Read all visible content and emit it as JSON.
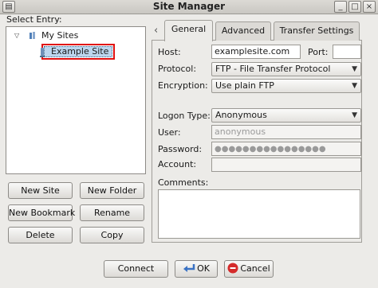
{
  "window": {
    "title": "Site Manager",
    "controls": {
      "minimize": "_",
      "maximize": "□",
      "close": "×"
    }
  },
  "tree": {
    "select_entry_label": "Select Entry:",
    "root_label": "My Sites",
    "selected_label": "Example Site",
    "expander": "▽"
  },
  "left_buttons": {
    "new_site": "New Site",
    "new_folder": "New Folder",
    "new_bookmark": "New Bookmark",
    "rename": "Rename",
    "delete": "Delete",
    "copy": "Copy"
  },
  "tabs": {
    "scroll_left": "‹",
    "items": [
      "General",
      "Advanced",
      "Transfer Settings"
    ],
    "active": "General"
  },
  "general": {
    "host_label": "Host:",
    "host_value": "examplesite.com",
    "port_label": "Port:",
    "port_value": "",
    "protocol_label": "Protocol:",
    "protocol_value": "FTP - File Transfer Protocol",
    "encryption_label": "Encryption:",
    "encryption_value": "Use plain FTP",
    "logon_type_label": "Logon Type:",
    "logon_type_value": "Anonymous",
    "user_label": "User:",
    "user_value": "anonymous",
    "password_label": "Password:",
    "password_value": "●●●●●●●●●●●●●●●●",
    "account_label": "Account:",
    "account_value": "",
    "comments_label": "Comments:",
    "comments_value": ""
  },
  "bottom_buttons": {
    "connect": "Connect",
    "ok": "OK",
    "cancel": "Cancel"
  },
  "colors": {
    "selection_highlight": "#bcd6ee",
    "selection_outline": "#e01010",
    "cancel_icon": "#d42a2a",
    "ok_icon": "#3a72c4"
  }
}
